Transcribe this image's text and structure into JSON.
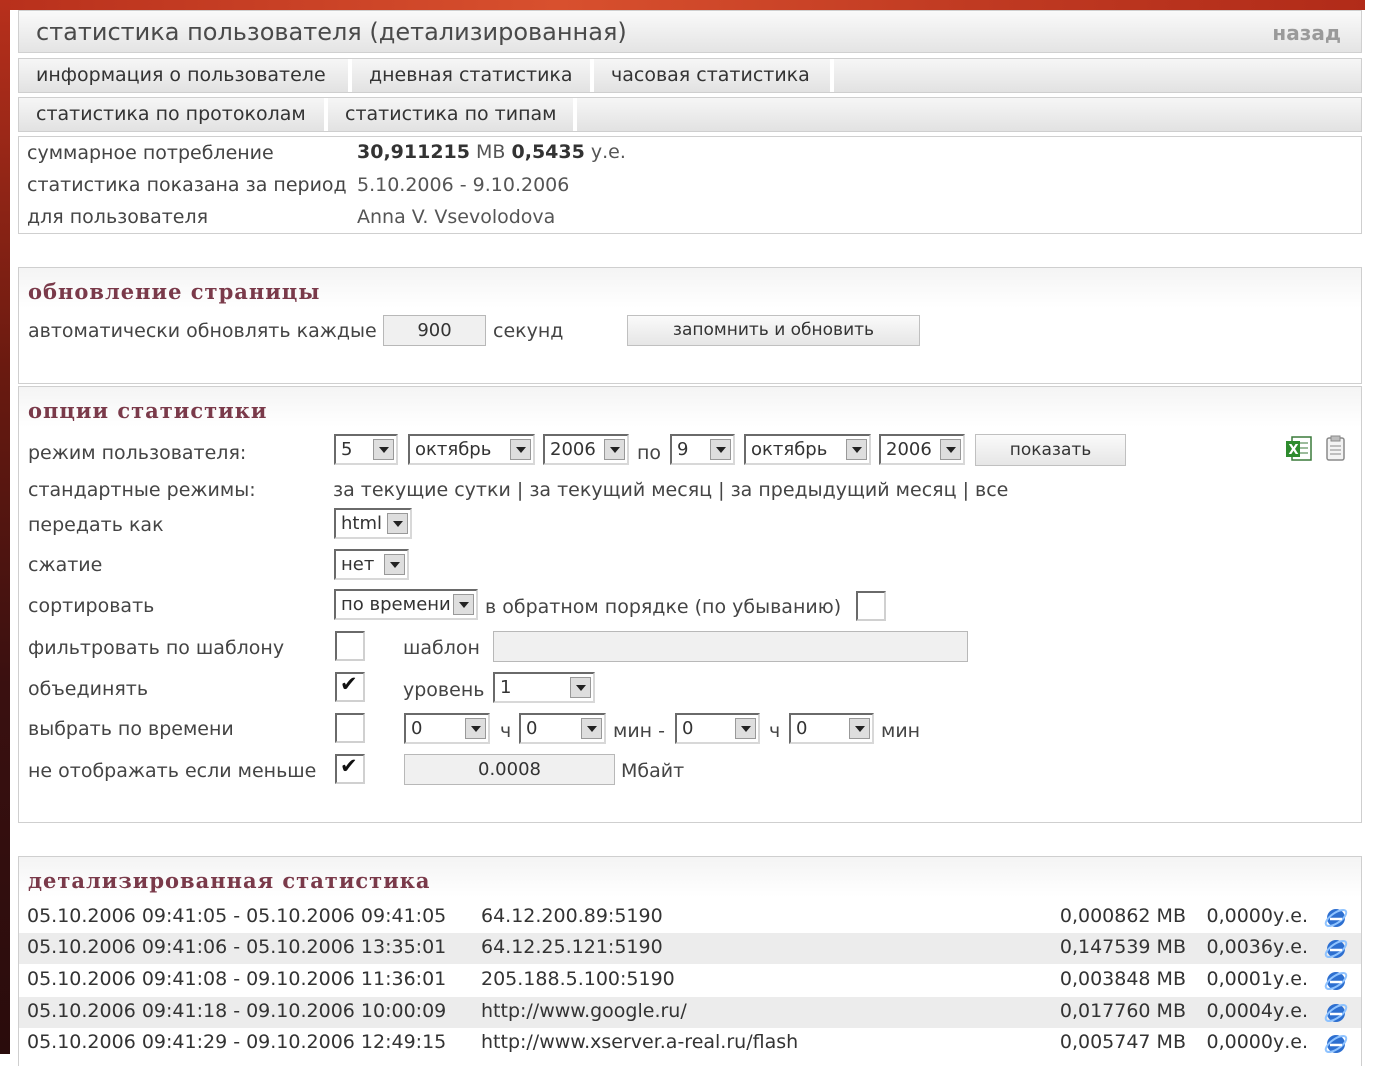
{
  "header": {
    "title": "статистика пользователя (детализированная)",
    "back_label": "назад"
  },
  "tabs_row1": [
    "информация о пользователе",
    "дневная статистика",
    "часовая статистика"
  ],
  "tabs_row2": [
    "статистика по протоколам",
    "статистика по типам"
  ],
  "summary": {
    "consumption_label": "суммарное потребление",
    "consumption_mb": "30,911215",
    "mb_unit": "MB",
    "consumption_ue": "0,5435",
    "ue_unit": "у.е.",
    "period_label": "статистика показана за период",
    "period_value": "5.10.2006 - 9.10.2006",
    "user_label": "для пользователя",
    "user_value": "Anna V. Vsevolodova"
  },
  "refresh": {
    "title": "обновление страницы",
    "label": "автоматически обновлять каждые",
    "interval": "900",
    "unit": "секунд",
    "button": "запомнить и обновить"
  },
  "options": {
    "title": "опции статистики",
    "user_mode_label": "режим пользователя:",
    "from_day": "5",
    "from_month": "октябрь",
    "from_year": "2006",
    "to_label": "по",
    "to_day": "9",
    "to_month": "октябрь",
    "to_year": "2006",
    "show_button": "показать",
    "std_modes_label": "стандартные режимы:",
    "std_modes": [
      "за текущие сутки",
      "за текущий месяц",
      "за предыдущий месяц",
      "все"
    ],
    "separator": "|",
    "send_as_label": "передать как",
    "send_as": "html",
    "compress_label": "сжатие",
    "compress": "нет",
    "sort_label": "сортировать",
    "sort": "по времени",
    "reverse_label": "в обратном порядке (по убыванию)",
    "filter_label": "фильтровать по шаблону",
    "pattern_label": "шаблон",
    "pattern_value": "",
    "merge_label": "объединять",
    "level_label": "уровень",
    "level": "1",
    "time_label": "выбрать по времени",
    "time_from_h": "0",
    "h_label": "ч",
    "time_from_m": "0",
    "min_dash_label": "мин -",
    "time_to_h": "0",
    "time_to_m": "0",
    "min_label": "мин",
    "hide_less_label": "не отображать если меньше",
    "hide_less_value": "0.0008",
    "mbyte_label": "Мбайт"
  },
  "detail": {
    "title": "детализированная статистика",
    "rows": [
      {
        "range": "05.10.2006 09:41:05 - 05.10.2006 09:41:05",
        "host": "64.12.200.89:5190",
        "mb": "0,000862 MB",
        "ue": "0,0000у.е."
      },
      {
        "range": "05.10.2006 09:41:06 - 05.10.2006 13:35:01",
        "host": "64.12.25.121:5190",
        "mb": "0,147539 MB",
        "ue": "0,0036у.е."
      },
      {
        "range": "05.10.2006 09:41:08 - 09.10.2006 11:36:01",
        "host": "205.188.5.100:5190",
        "mb": "0,003848 MB",
        "ue": "0,0001у.е."
      },
      {
        "range": "05.10.2006 09:41:18 - 09.10.2006 10:00:09",
        "host": "http://www.google.ru/",
        "mb": "0,017760 MB",
        "ue": "0,0004у.е."
      },
      {
        "range": "05.10.2006 09:41:29 - 09.10.2006 12:49:15",
        "host": "http://www.xserver.a-real.ru/flash",
        "mb": "0,005747 MB",
        "ue": "0,0000у.е."
      }
    ]
  },
  "colors": {
    "accent_title": "#7a3a4a",
    "frame_red": "#b8301c",
    "row_alt": "#ececec"
  }
}
